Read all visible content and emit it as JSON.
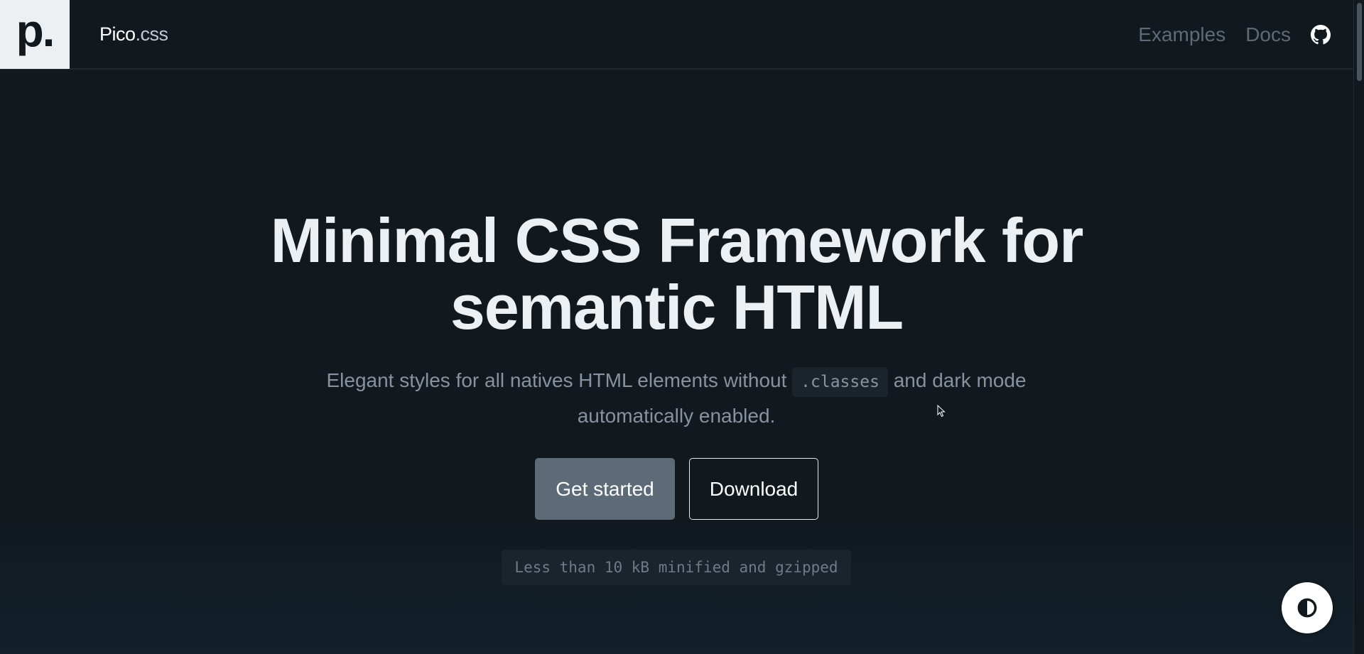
{
  "header": {
    "logo": "p.",
    "brand_name": "Pico",
    "brand_ext": ".css",
    "nav": [
      {
        "label": "Examples"
      },
      {
        "label": "Docs"
      }
    ],
    "github_icon": "github-icon"
  },
  "hero": {
    "title_line1": "Minimal CSS Framework for",
    "title_line2": "semantic HTML",
    "subtitle_before": "Elegant styles for all natives HTML elements without ",
    "subtitle_code": ".classes",
    "subtitle_after": " and dark mode automatically enabled.",
    "primary_label": "Get started",
    "secondary_label": "Download",
    "note": "Less than 10 kB minified and gzipped"
  },
  "theme_toggle_icon": "contrast-icon",
  "colors": {
    "background": "#11191f",
    "primary_button": "#5d6b78",
    "nav_link": "#5d6b78"
  }
}
